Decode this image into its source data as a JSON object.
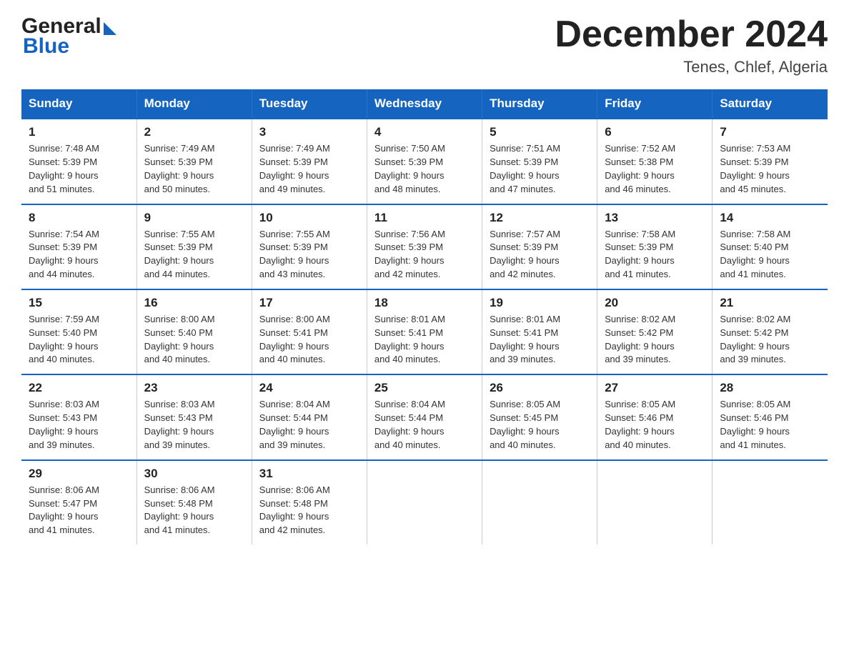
{
  "header": {
    "logo_general": "General",
    "logo_blue": "Blue",
    "month_title": "December 2024",
    "location": "Tenes, Chlef, Algeria"
  },
  "days_of_week": [
    "Sunday",
    "Monday",
    "Tuesday",
    "Wednesday",
    "Thursday",
    "Friday",
    "Saturday"
  ],
  "weeks": [
    [
      {
        "day": "1",
        "sunrise": "7:48 AM",
        "sunset": "5:39 PM",
        "daylight": "9 hours and 51 minutes."
      },
      {
        "day": "2",
        "sunrise": "7:49 AM",
        "sunset": "5:39 PM",
        "daylight": "9 hours and 50 minutes."
      },
      {
        "day": "3",
        "sunrise": "7:49 AM",
        "sunset": "5:39 PM",
        "daylight": "9 hours and 49 minutes."
      },
      {
        "day": "4",
        "sunrise": "7:50 AM",
        "sunset": "5:39 PM",
        "daylight": "9 hours and 48 minutes."
      },
      {
        "day": "5",
        "sunrise": "7:51 AM",
        "sunset": "5:39 PM",
        "daylight": "9 hours and 47 minutes."
      },
      {
        "day": "6",
        "sunrise": "7:52 AM",
        "sunset": "5:38 PM",
        "daylight": "9 hours and 46 minutes."
      },
      {
        "day": "7",
        "sunrise": "7:53 AM",
        "sunset": "5:39 PM",
        "daylight": "9 hours and 45 minutes."
      }
    ],
    [
      {
        "day": "8",
        "sunrise": "7:54 AM",
        "sunset": "5:39 PM",
        "daylight": "9 hours and 44 minutes."
      },
      {
        "day": "9",
        "sunrise": "7:55 AM",
        "sunset": "5:39 PM",
        "daylight": "9 hours and 44 minutes."
      },
      {
        "day": "10",
        "sunrise": "7:55 AM",
        "sunset": "5:39 PM",
        "daylight": "9 hours and 43 minutes."
      },
      {
        "day": "11",
        "sunrise": "7:56 AM",
        "sunset": "5:39 PM",
        "daylight": "9 hours and 42 minutes."
      },
      {
        "day": "12",
        "sunrise": "7:57 AM",
        "sunset": "5:39 PM",
        "daylight": "9 hours and 42 minutes."
      },
      {
        "day": "13",
        "sunrise": "7:58 AM",
        "sunset": "5:39 PM",
        "daylight": "9 hours and 41 minutes."
      },
      {
        "day": "14",
        "sunrise": "7:58 AM",
        "sunset": "5:40 PM",
        "daylight": "9 hours and 41 minutes."
      }
    ],
    [
      {
        "day": "15",
        "sunrise": "7:59 AM",
        "sunset": "5:40 PM",
        "daylight": "9 hours and 40 minutes."
      },
      {
        "day": "16",
        "sunrise": "8:00 AM",
        "sunset": "5:40 PM",
        "daylight": "9 hours and 40 minutes."
      },
      {
        "day": "17",
        "sunrise": "8:00 AM",
        "sunset": "5:41 PM",
        "daylight": "9 hours and 40 minutes."
      },
      {
        "day": "18",
        "sunrise": "8:01 AM",
        "sunset": "5:41 PM",
        "daylight": "9 hours and 40 minutes."
      },
      {
        "day": "19",
        "sunrise": "8:01 AM",
        "sunset": "5:41 PM",
        "daylight": "9 hours and 39 minutes."
      },
      {
        "day": "20",
        "sunrise": "8:02 AM",
        "sunset": "5:42 PM",
        "daylight": "9 hours and 39 minutes."
      },
      {
        "day": "21",
        "sunrise": "8:02 AM",
        "sunset": "5:42 PM",
        "daylight": "9 hours and 39 minutes."
      }
    ],
    [
      {
        "day": "22",
        "sunrise": "8:03 AM",
        "sunset": "5:43 PM",
        "daylight": "9 hours and 39 minutes."
      },
      {
        "day": "23",
        "sunrise": "8:03 AM",
        "sunset": "5:43 PM",
        "daylight": "9 hours and 39 minutes."
      },
      {
        "day": "24",
        "sunrise": "8:04 AM",
        "sunset": "5:44 PM",
        "daylight": "9 hours and 39 minutes."
      },
      {
        "day": "25",
        "sunrise": "8:04 AM",
        "sunset": "5:44 PM",
        "daylight": "9 hours and 40 minutes."
      },
      {
        "day": "26",
        "sunrise": "8:05 AM",
        "sunset": "5:45 PM",
        "daylight": "9 hours and 40 minutes."
      },
      {
        "day": "27",
        "sunrise": "8:05 AM",
        "sunset": "5:46 PM",
        "daylight": "9 hours and 40 minutes."
      },
      {
        "day": "28",
        "sunrise": "8:05 AM",
        "sunset": "5:46 PM",
        "daylight": "9 hours and 41 minutes."
      }
    ],
    [
      {
        "day": "29",
        "sunrise": "8:06 AM",
        "sunset": "5:47 PM",
        "daylight": "9 hours and 41 minutes."
      },
      {
        "day": "30",
        "sunrise": "8:06 AM",
        "sunset": "5:48 PM",
        "daylight": "9 hours and 41 minutes."
      },
      {
        "day": "31",
        "sunrise": "8:06 AM",
        "sunset": "5:48 PM",
        "daylight": "9 hours and 42 minutes."
      },
      null,
      null,
      null,
      null
    ]
  ],
  "labels": {
    "sunrise": "Sunrise:",
    "sunset": "Sunset:",
    "daylight": "Daylight:"
  }
}
